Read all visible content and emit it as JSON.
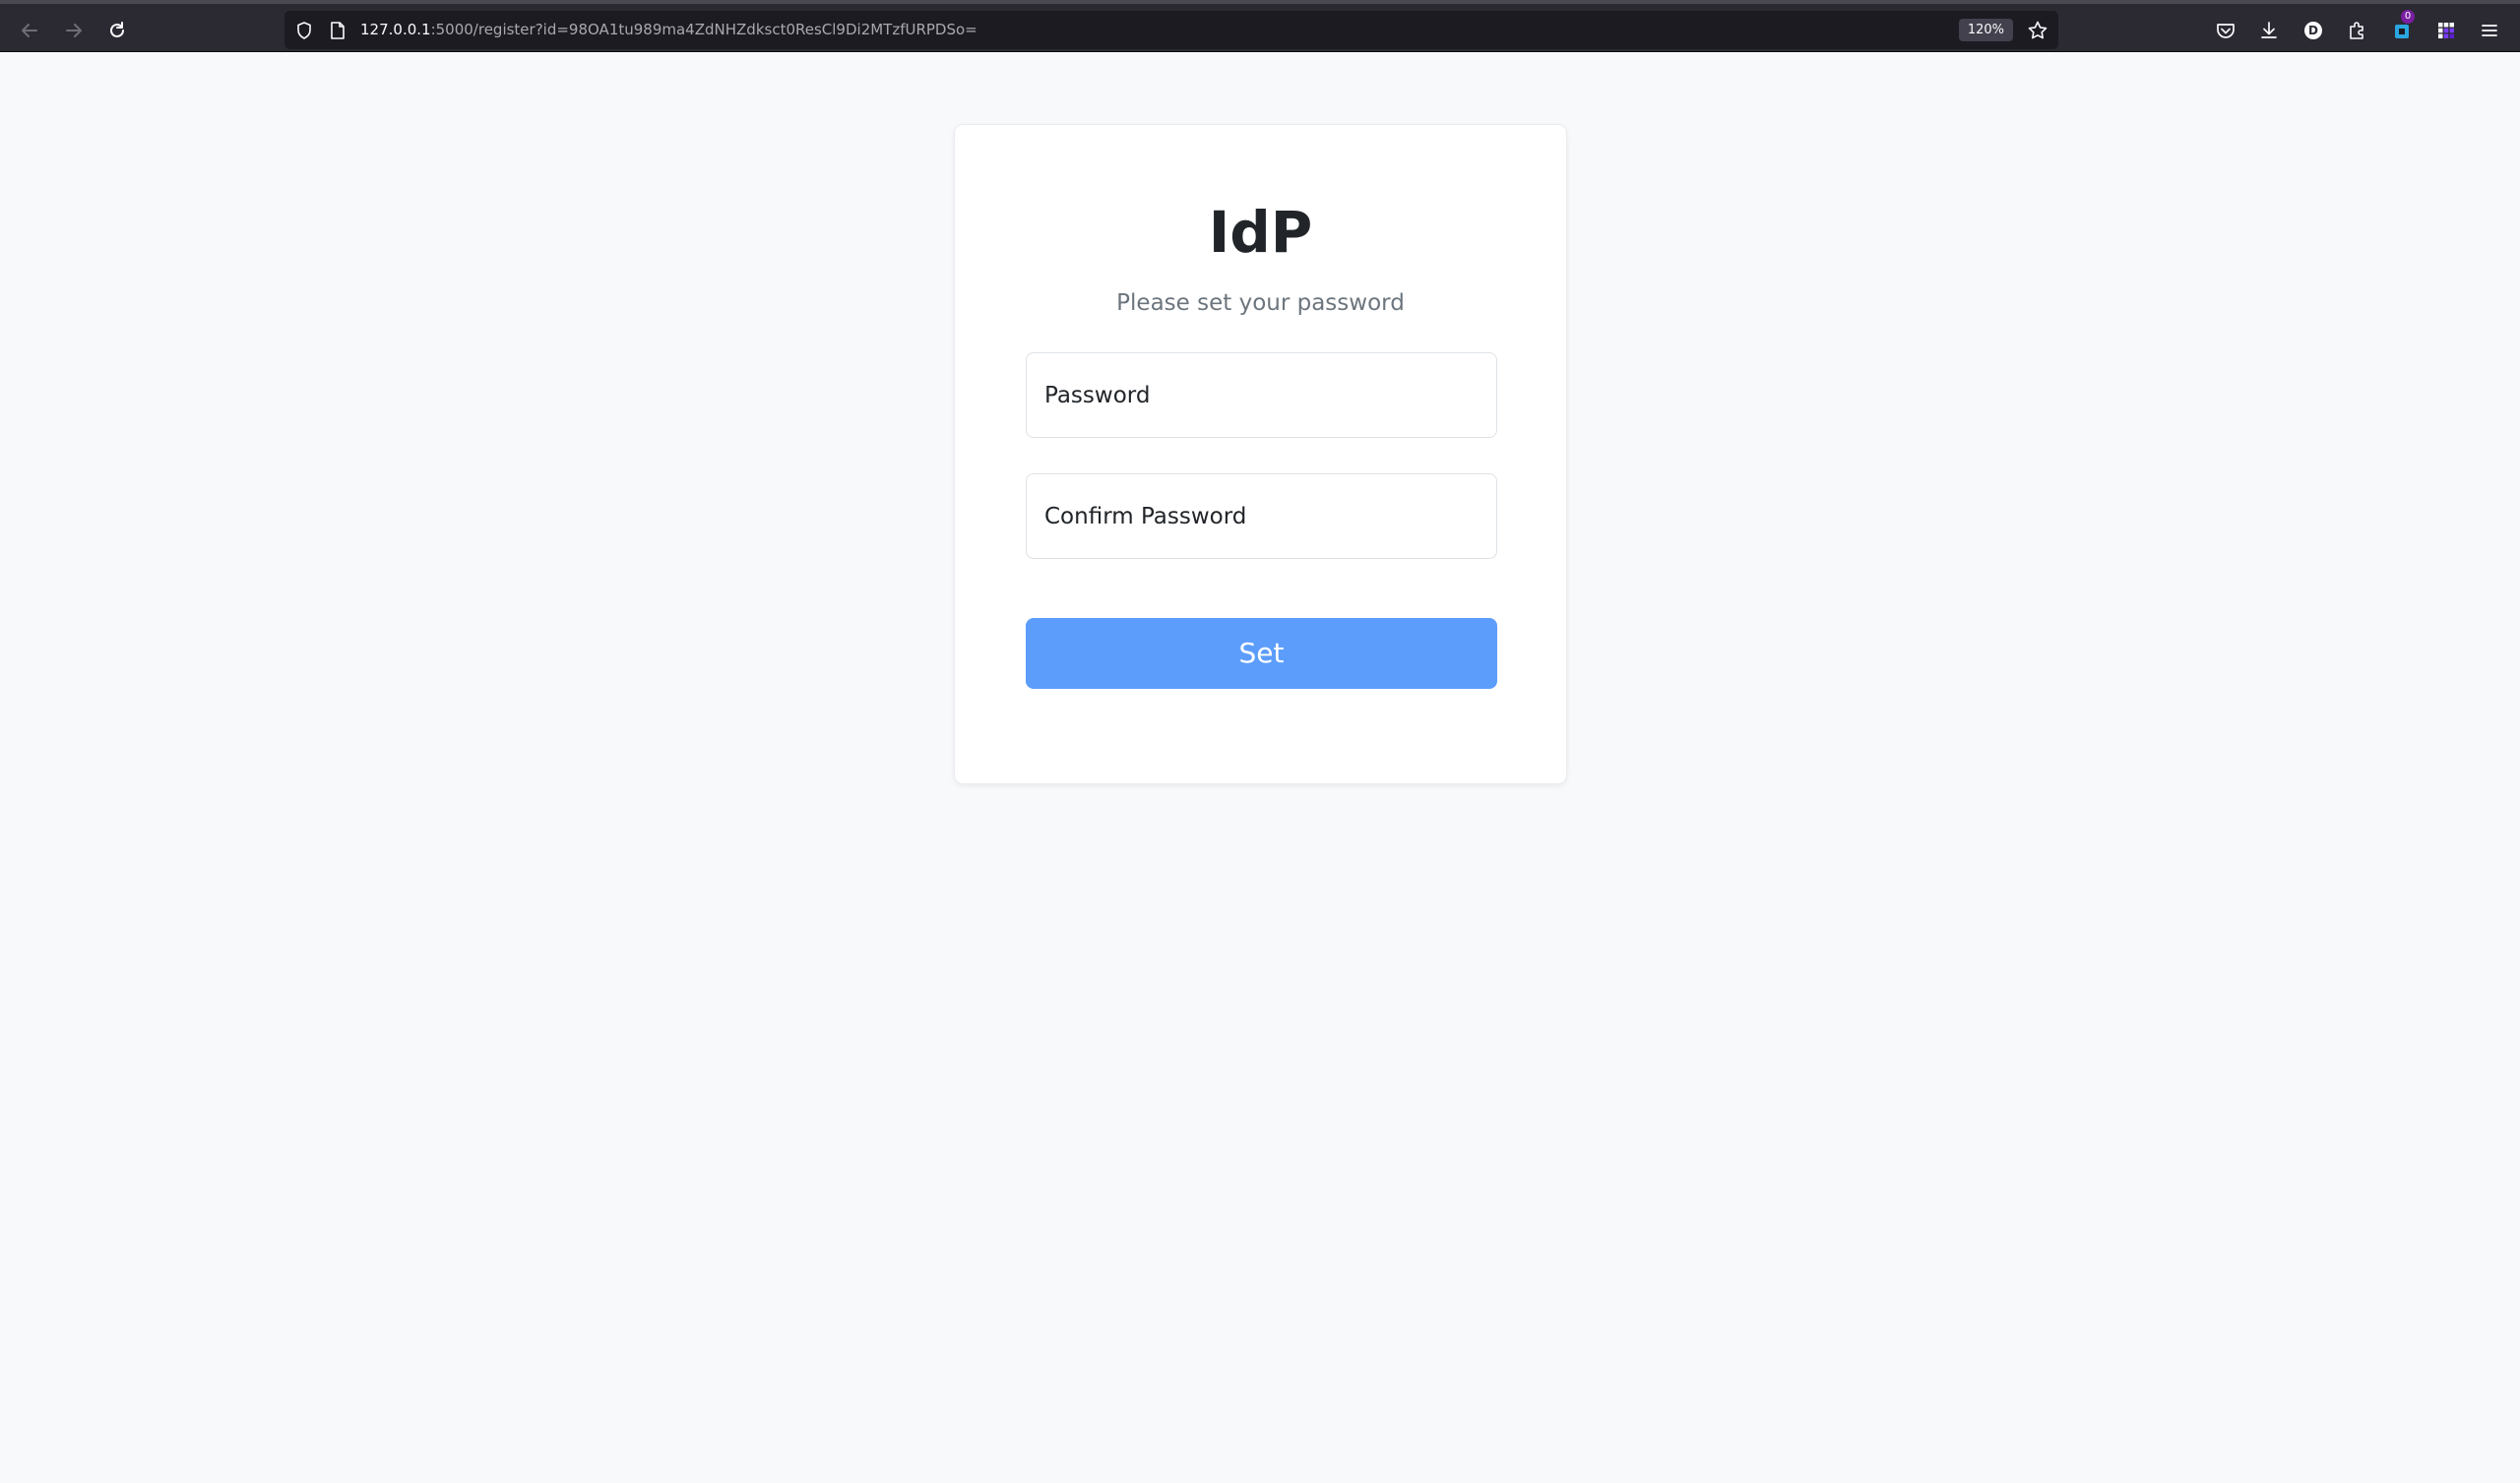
{
  "browser": {
    "url_host": "127.0.0.1",
    "url_rest": ":5000/register?id=98OA1tu989ma4ZdNHZdksct0ResCl9Di2MTzfURPDSo=",
    "zoom": "120%",
    "extension_badge": "0",
    "account_initial": "D",
    "icons": {
      "back": "back-arrow-icon",
      "forward": "forward-arrow-icon",
      "reload": "reload-icon",
      "tracking_protection": "shield-icon",
      "page_info": "page-icon",
      "bookmark": "star-icon",
      "pocket": "pocket-icon",
      "downloads": "download-icon",
      "account": "account-icon",
      "extensions": "puzzle-icon",
      "menu": "hamburger-menu-icon"
    }
  },
  "page": {
    "title": "IdP",
    "subtitle": "Please set your password",
    "password_placeholder": "Password",
    "confirm_placeholder": "Confirm Password",
    "submit_label": "Set"
  },
  "colors": {
    "accent": "#5c9dfb",
    "page_background": "#f8f9fb",
    "toolbar_background": "#2b2a33"
  }
}
